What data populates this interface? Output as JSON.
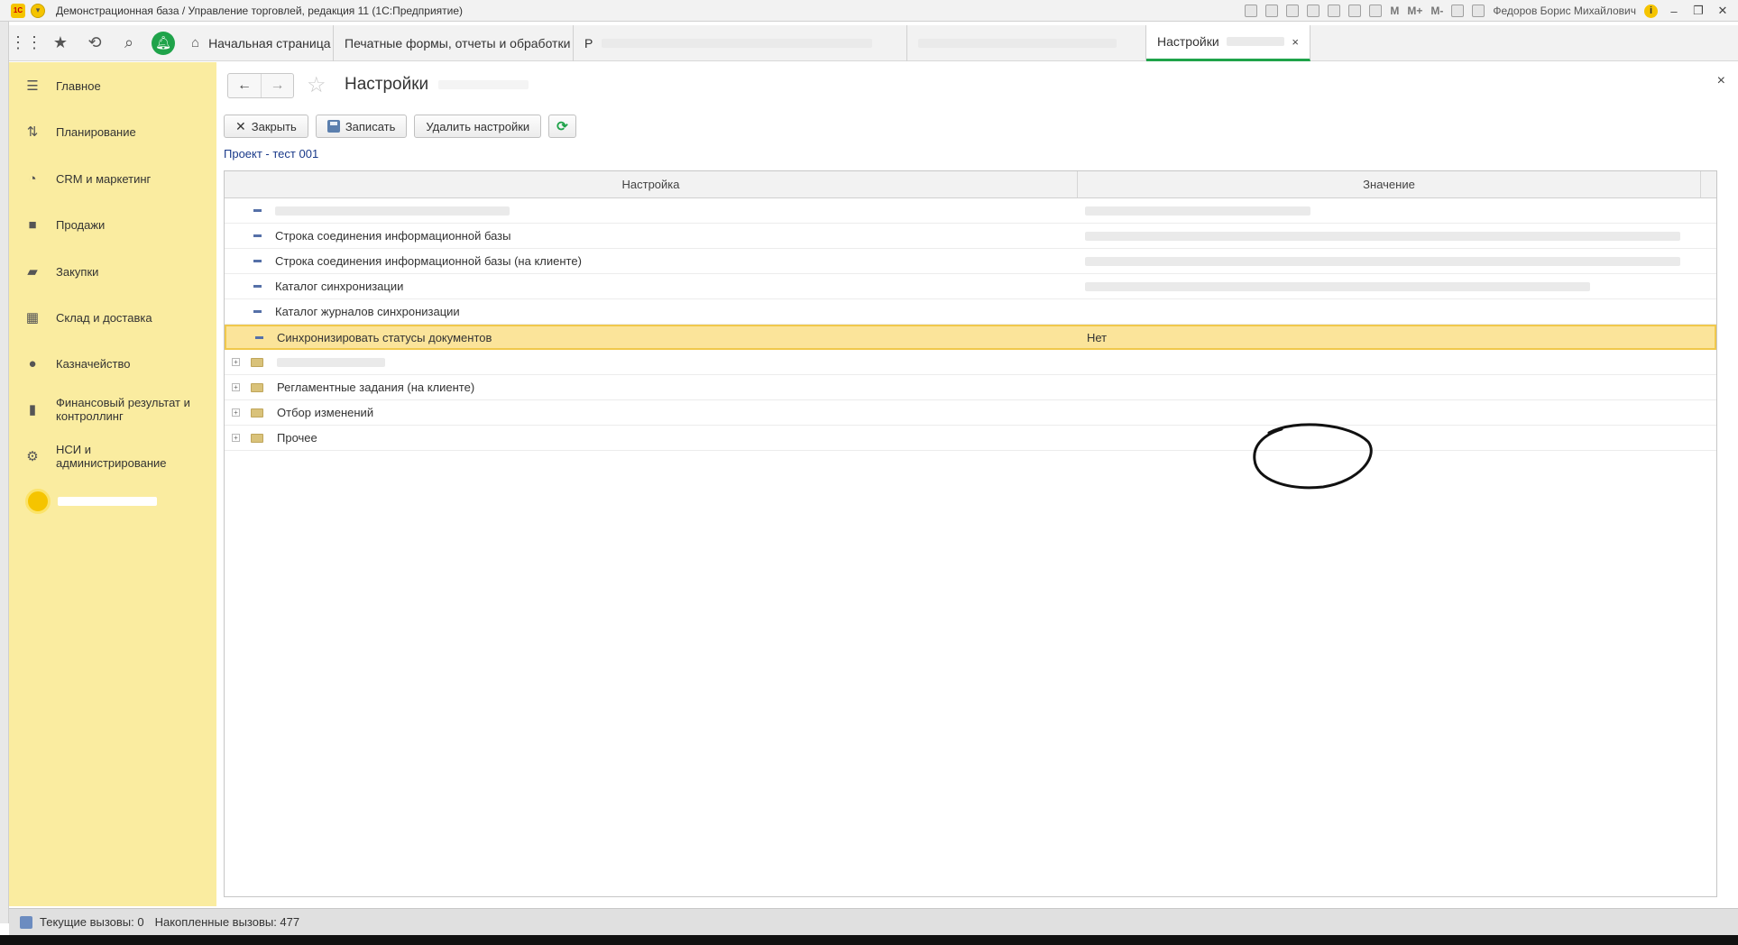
{
  "window": {
    "title": "Демонстрационная база / Управление торговлей, редакция 11  (1С:Предприятие)",
    "logo_text": "1С",
    "user": "Федоров Борис Михайлович",
    "m_buttons": [
      "M",
      "M+",
      "M-"
    ],
    "win_controls": [
      "‒",
      "❐",
      "✕"
    ]
  },
  "topbar": {
    "tabs": [
      {
        "label": "Начальная страница",
        "icon": "home-icon"
      },
      {
        "label": "Печатные формы, отчеты и обработки",
        "close": "×"
      },
      {
        "label": "Р",
        "redacted": true
      },
      {
        "label": "",
        "redacted": true
      },
      {
        "label": "Настройки",
        "close": "×",
        "active": true
      }
    ]
  },
  "sidebar": {
    "items": [
      {
        "label": "Главное",
        "icon": "menu-icon"
      },
      {
        "label": "Планирование",
        "icon": "planning-icon"
      },
      {
        "label": "CRM и маркетинг",
        "icon": "pie-chart-icon"
      },
      {
        "label": "Продажи",
        "icon": "bag-icon"
      },
      {
        "label": "Закупки",
        "icon": "cart-icon"
      },
      {
        "label": "Склад и доставка",
        "icon": "warehouse-icon"
      },
      {
        "label": "Казначейство",
        "icon": "coin-icon"
      },
      {
        "label": "Финансовый результат и контроллинг",
        "icon": "bar-chart-icon"
      },
      {
        "label": "НСИ и администрирование",
        "icon": "gear-icon"
      }
    ]
  },
  "main": {
    "title": "Настройки",
    "close_symbol": "×",
    "buttons": {
      "close": "Закрыть",
      "save": "Записать",
      "delete_settings": "Удалить настройки"
    },
    "project": "Проект - тест 001",
    "table": {
      "columns": [
        "Настройка",
        "Значение"
      ],
      "rows": [
        {
          "type": "item",
          "name": "",
          "value": "",
          "redacted": true
        },
        {
          "type": "item",
          "name": "Строка соединения информационной базы",
          "value": "",
          "redacted_value": true
        },
        {
          "type": "item",
          "name": "Строка соединения информационной базы (на клиенте)",
          "value": "",
          "redacted_value": true
        },
        {
          "type": "item",
          "name": "Каталог синхронизации",
          "value": "",
          "redacted_value": true
        },
        {
          "type": "item",
          "name": "Каталог журналов синхронизации",
          "value": ""
        },
        {
          "type": "item",
          "name": "Синхронизировать статусы документов",
          "value": "Нет",
          "selected": true
        },
        {
          "type": "group",
          "name": "",
          "redacted": true
        },
        {
          "type": "group",
          "name": "Регламентные задания (на клиенте)"
        },
        {
          "type": "group",
          "name": "Отбор изменений"
        },
        {
          "type": "group",
          "name": "Прочее"
        }
      ]
    }
  },
  "statusbar": {
    "current_calls": "Текущие вызовы: 0",
    "accumulated_calls": "Накопленные вызовы: 477"
  },
  "colors": {
    "sidebar_bg": "#faeca0",
    "selected_row": "#fbe49a",
    "accent_green": "#1fa34a",
    "link_blue": "#1a3a8a"
  }
}
